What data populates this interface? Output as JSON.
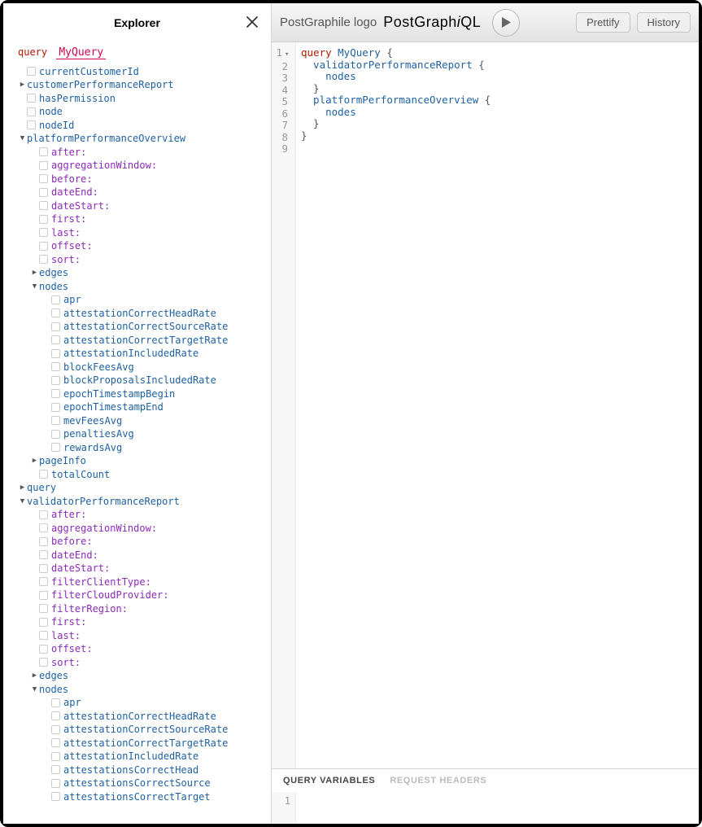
{
  "explorer": {
    "title": "Explorer",
    "query_keyword": "query",
    "query_name": "MyQuery",
    "tree": [
      {
        "ind": 1,
        "kind": "field",
        "text": "currentCustomerId",
        "cb": true
      },
      {
        "ind": 1,
        "kind": "field",
        "text": "customerPerformanceReport",
        "toggle": "right"
      },
      {
        "ind": 1,
        "kind": "field",
        "text": "hasPermission",
        "cb": true
      },
      {
        "ind": 1,
        "kind": "field",
        "text": "node",
        "cb": true
      },
      {
        "ind": 1,
        "kind": "field",
        "text": "nodeId",
        "cb": true
      },
      {
        "ind": 1,
        "kind": "field",
        "text": "platformPerformanceOverview",
        "toggle": "down"
      },
      {
        "ind": 2,
        "kind": "arg",
        "text": "after",
        "cb": true
      },
      {
        "ind": 2,
        "kind": "arg",
        "text": "aggregationWindow",
        "cb": true
      },
      {
        "ind": 2,
        "kind": "arg",
        "text": "before",
        "cb": true
      },
      {
        "ind": 2,
        "kind": "arg",
        "text": "dateEnd",
        "cb": true
      },
      {
        "ind": 2,
        "kind": "arg",
        "text": "dateStart",
        "cb": true
      },
      {
        "ind": 2,
        "kind": "arg",
        "text": "first",
        "cb": true
      },
      {
        "ind": 2,
        "kind": "arg",
        "text": "last",
        "cb": true
      },
      {
        "ind": 2,
        "kind": "arg",
        "text": "offset",
        "cb": true
      },
      {
        "ind": 2,
        "kind": "arg",
        "text": "sort",
        "cb": true
      },
      {
        "ind": 2,
        "kind": "field",
        "text": "edges",
        "toggle": "right"
      },
      {
        "ind": 2,
        "kind": "field",
        "text": "nodes",
        "toggle": "down"
      },
      {
        "ind": 3,
        "kind": "field",
        "text": "apr",
        "cb": true
      },
      {
        "ind": 3,
        "kind": "field",
        "text": "attestationCorrectHeadRate",
        "cb": true
      },
      {
        "ind": 3,
        "kind": "field",
        "text": "attestationCorrectSourceRate",
        "cb": true
      },
      {
        "ind": 3,
        "kind": "field",
        "text": "attestationCorrectTargetRate",
        "cb": true
      },
      {
        "ind": 3,
        "kind": "field",
        "text": "attestationIncludedRate",
        "cb": true
      },
      {
        "ind": 3,
        "kind": "field",
        "text": "blockFeesAvg",
        "cb": true
      },
      {
        "ind": 3,
        "kind": "field",
        "text": "blockProposalsIncludedRate",
        "cb": true
      },
      {
        "ind": 3,
        "kind": "field",
        "text": "epochTimestampBegin",
        "cb": true
      },
      {
        "ind": 3,
        "kind": "field",
        "text": "epochTimestampEnd",
        "cb": true
      },
      {
        "ind": 3,
        "kind": "field",
        "text": "mevFeesAvg",
        "cb": true
      },
      {
        "ind": 3,
        "kind": "field",
        "text": "penaltiesAvg",
        "cb": true
      },
      {
        "ind": 3,
        "kind": "field",
        "text": "rewardsAvg",
        "cb": true
      },
      {
        "ind": 2,
        "kind": "field",
        "text": "pageInfo",
        "toggle": "right"
      },
      {
        "ind": 2,
        "kind": "field",
        "text": "totalCount",
        "cb": true
      },
      {
        "ind": 1,
        "kind": "field",
        "text": "query",
        "toggle": "right"
      },
      {
        "ind": 1,
        "kind": "field",
        "text": "validatorPerformanceReport",
        "toggle": "down"
      },
      {
        "ind": 2,
        "kind": "arg",
        "text": "after",
        "cb": true
      },
      {
        "ind": 2,
        "kind": "arg",
        "text": "aggregationWindow",
        "cb": true
      },
      {
        "ind": 2,
        "kind": "arg",
        "text": "before",
        "cb": true
      },
      {
        "ind": 2,
        "kind": "arg",
        "text": "dateEnd",
        "cb": true
      },
      {
        "ind": 2,
        "kind": "arg",
        "text": "dateStart",
        "cb": true
      },
      {
        "ind": 2,
        "kind": "arg",
        "text": "filterClientType",
        "cb": true
      },
      {
        "ind": 2,
        "kind": "arg",
        "text": "filterCloudProvider",
        "cb": true
      },
      {
        "ind": 2,
        "kind": "arg",
        "text": "filterRegion",
        "cb": true
      },
      {
        "ind": 2,
        "kind": "arg",
        "text": "first",
        "cb": true
      },
      {
        "ind": 2,
        "kind": "arg",
        "text": "last",
        "cb": true
      },
      {
        "ind": 2,
        "kind": "arg",
        "text": "offset",
        "cb": true
      },
      {
        "ind": 2,
        "kind": "arg",
        "text": "sort",
        "cb": true
      },
      {
        "ind": 2,
        "kind": "field",
        "text": "edges",
        "toggle": "right"
      },
      {
        "ind": 2,
        "kind": "field",
        "text": "nodes",
        "toggle": "down"
      },
      {
        "ind": 3,
        "kind": "field",
        "text": "apr",
        "cb": true
      },
      {
        "ind": 3,
        "kind": "field",
        "text": "attestationCorrectHeadRate",
        "cb": true
      },
      {
        "ind": 3,
        "kind": "field",
        "text": "attestationCorrectSourceRate",
        "cb": true
      },
      {
        "ind": 3,
        "kind": "field",
        "text": "attestationCorrectTargetRate",
        "cb": true
      },
      {
        "ind": 3,
        "kind": "field",
        "text": "attestationIncludedRate",
        "cb": true
      },
      {
        "ind": 3,
        "kind": "field",
        "text": "attestationsCorrectHead",
        "cb": true
      },
      {
        "ind": 3,
        "kind": "field",
        "text": "attestationsCorrectSource",
        "cb": true
      },
      {
        "ind": 3,
        "kind": "field",
        "text": "attestationsCorrectTarget",
        "cb": true
      }
    ]
  },
  "toolbar": {
    "logo_text": "PostGraphile logo",
    "brand_pre": "PostGraph",
    "brand_i": "i",
    "brand_post": "QL",
    "prettify": "Prettify",
    "history": "History"
  },
  "editor": {
    "lines": [
      {
        "n": "1",
        "fold": true,
        "segments": [
          {
            "t": "query ",
            "c": "c-kw"
          },
          {
            "t": "MyQuery ",
            "c": "c-def"
          },
          {
            "t": "{",
            "c": "c-punc"
          }
        ]
      },
      {
        "n": "2",
        "segments": [
          {
            "t": "  validatorPerformanceReport ",
            "c": "c-attr"
          },
          {
            "t": "{",
            "c": "c-punc"
          }
        ]
      },
      {
        "n": "3",
        "segments": [
          {
            "t": "    nodes",
            "c": "c-attr"
          }
        ]
      },
      {
        "n": "4",
        "segments": [
          {
            "t": "  }",
            "c": "c-punc"
          }
        ]
      },
      {
        "n": "5",
        "segments": [
          {
            "t": "  platformPerformanceOverview ",
            "c": "c-attr"
          },
          {
            "t": "{",
            "c": "c-punc"
          }
        ]
      },
      {
        "n": "6",
        "segments": [
          {
            "t": "    nodes",
            "c": "c-attr"
          }
        ]
      },
      {
        "n": "7",
        "segments": [
          {
            "t": "  }",
            "c": "c-punc"
          }
        ]
      },
      {
        "n": "8",
        "segments": [
          {
            "t": "}",
            "c": "c-punc"
          }
        ]
      },
      {
        "n": "9",
        "segments": [
          {
            "t": "",
            "c": ""
          }
        ]
      }
    ]
  },
  "vars": {
    "tab_qv": "QUERY VARIABLES",
    "tab_rh": "REQUEST HEADERS",
    "line1": "1"
  }
}
